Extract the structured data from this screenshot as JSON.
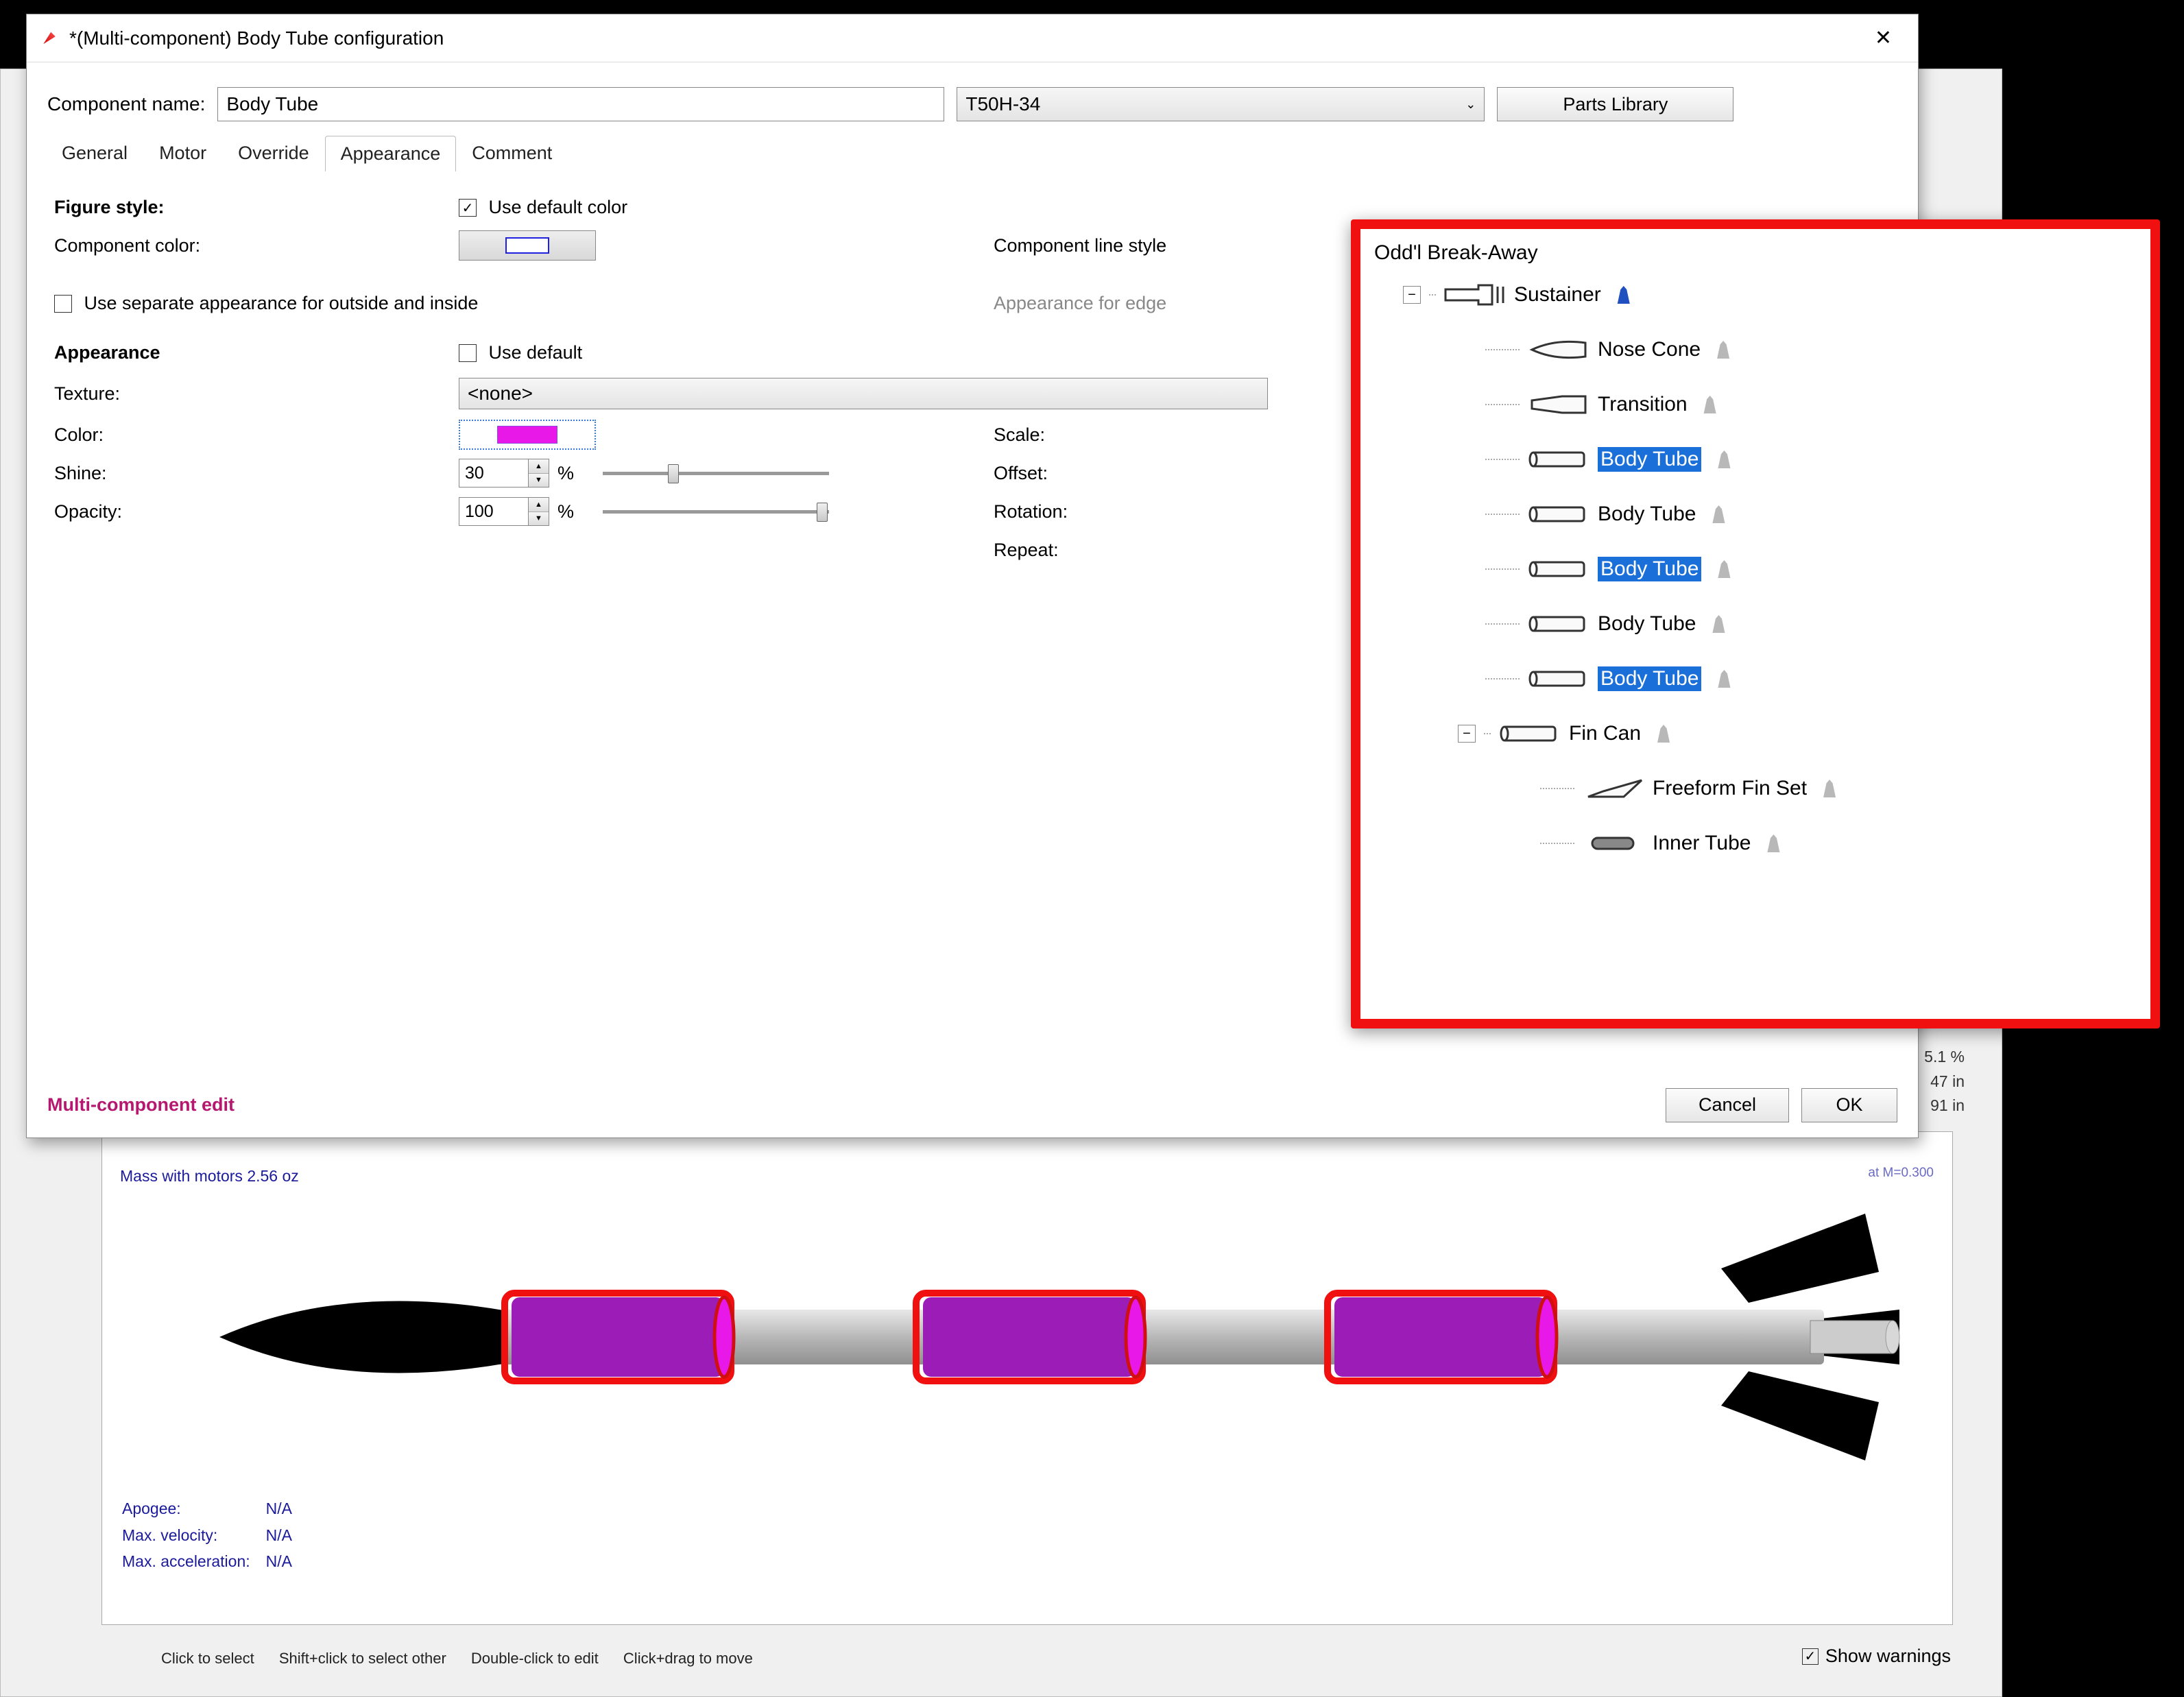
{
  "window": {
    "title": "*(Multi-component) Body Tube configuration"
  },
  "header": {
    "component_name_label": "Component name:",
    "component_name_value": "Body Tube",
    "preset_value": "T50H-34",
    "parts_library": "Parts Library"
  },
  "tabs": [
    "General",
    "Motor",
    "Override",
    "Appearance",
    "Comment"
  ],
  "active_tab": "Appearance",
  "appearance": {
    "figure_style_label": "Figure style:",
    "use_default_color_label": "Use default color",
    "use_default_color_checked": true,
    "component_color_label": "Component color:",
    "component_line_style_label": "Component line style",
    "use_separate_label": "Use separate appearance for outside and inside",
    "use_separate_checked": false,
    "appearance_for_edge_label": "Appearance for edge",
    "appearance_header": "Appearance",
    "use_default_label": "Use default",
    "use_default_checked": false,
    "texture_label": "Texture:",
    "texture_value": "<none>",
    "color_label": "Color:",
    "color_value": "#E818E8",
    "shine_label": "Shine:",
    "shine_value": "30",
    "shine_unit": "%",
    "opacity_label": "Opacity:",
    "opacity_value": "100",
    "opacity_unit": "%",
    "scale_label": "Scale:",
    "offset_label": "Offset:",
    "rotation_label": "Rotation:",
    "repeat_label": "Repeat:"
  },
  "footer": {
    "multi_edit": "Multi-component edit",
    "cancel": "Cancel",
    "ok": "OK"
  },
  "tree": {
    "root": "Odd'l Break-Away",
    "sustainer": "Sustainer",
    "items": [
      {
        "label": "Nose Cone",
        "selected": false,
        "icon": "nosecone"
      },
      {
        "label": "Transition",
        "selected": false,
        "icon": "transition"
      },
      {
        "label": "Body Tube",
        "selected": true,
        "icon": "tube"
      },
      {
        "label": "Body Tube",
        "selected": false,
        "icon": "tube"
      },
      {
        "label": "Body Tube",
        "selected": true,
        "icon": "tube"
      },
      {
        "label": "Body Tube",
        "selected": false,
        "icon": "tube"
      },
      {
        "label": "Body Tube",
        "selected": true,
        "icon": "tube"
      }
    ],
    "fincan": "Fin Can",
    "fincan_children": [
      {
        "label": "Freeform Fin Set",
        "icon": "fin"
      },
      {
        "label": "Inner Tube",
        "icon": "innertube"
      }
    ]
  },
  "preview": {
    "mass_line": "Mass with motors 2.56 oz",
    "m_label": "at M=0.300",
    "apogee_label": "Apogee:",
    "apogee_value": "N/A",
    "maxvel_label": "Max. velocity:",
    "maxvel_value": "N/A",
    "maxacc_label": "Max. acceleration:",
    "maxacc_value": "N/A",
    "side_pct": "5.1 %",
    "side_in1": "47 in",
    "side_in2": "91 in"
  },
  "hints": {
    "h1": "Click to select",
    "h2": "Shift+click to select other",
    "h3": "Double-click to edit",
    "h4": "Click+drag to move",
    "show_warnings": "Show warnings",
    "show_warnings_checked": true
  }
}
